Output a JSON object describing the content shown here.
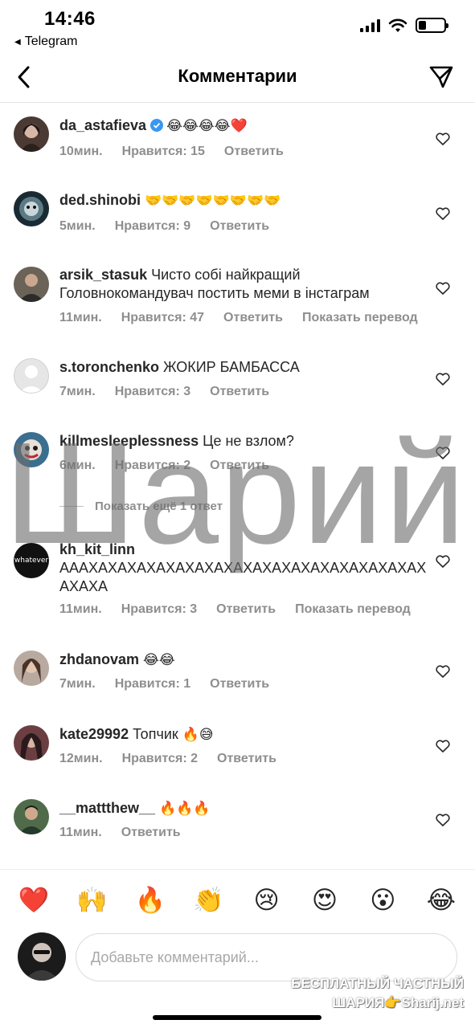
{
  "status_bar": {
    "time": "14:46",
    "back_app": "Telegram"
  },
  "header": {
    "title": "Комментарии"
  },
  "comments": [
    {
      "username": "da_astafieva",
      "verified": true,
      "text": "",
      "emoji": "😂😂😂😂❤️",
      "time": "10мин.",
      "likes": "Нравится: 15",
      "reply": "Ответить"
    },
    {
      "username": "ded.shinobi",
      "text": "",
      "emoji": "🤝🤝🤝🤝🤝🤝🤝🤝",
      "time": "5мин.",
      "likes": "Нравится: 9",
      "reply": "Ответить"
    },
    {
      "username": "arsik_stasuk",
      "text": "Чисто собі найкращий Головнокомандувач постить меми в інстаграм",
      "time": "11мин.",
      "likes": "Нравится: 47",
      "reply": "Ответить",
      "translate": "Показать перевод"
    },
    {
      "username": "s.toronchenko",
      "text": "ЖОКИР БАМБАССА",
      "time": "7мин.",
      "likes": "Нравится: 3",
      "reply": "Ответить"
    },
    {
      "username": "killmesleeplessness",
      "text": "Це не взлом?",
      "time": "6мин.",
      "likes": "Нравится: 2",
      "reply": "Ответить"
    },
    {
      "username": "kh_kit_linn",
      "text": "АААХАХАХАХАХАХАХАХАХАХАХАХАХАХАХАХАХАХАХАХА",
      "time": "11мин.",
      "likes": "Нравится: 3",
      "reply": "Ответить",
      "translate": "Показать перевод",
      "avatar_text": "whatever"
    },
    {
      "username": "zhdanovam",
      "text": "",
      "emoji": "😂😂",
      "time": "7мин.",
      "likes": "Нравится: 1",
      "reply": "Ответить"
    },
    {
      "username": "kate29992",
      "text": "Топчик",
      "emoji": "🔥😅",
      "time": "12мин.",
      "likes": "Нравится: 2",
      "reply": "Ответить"
    },
    {
      "username": "__mattthew__",
      "text": "",
      "emoji": "🔥🔥🔥",
      "time": "11мин.",
      "likes": "",
      "reply": "Ответить"
    }
  ],
  "more_replies": "Показать ещё 1 ответ",
  "watermark": "Шарий",
  "reactions": [
    "❤️",
    "🙌",
    "🔥",
    "👏",
    "😢",
    "😍",
    "😮",
    "😂"
  ],
  "composer": {
    "placeholder": "Добавьте комментарий..."
  },
  "watermark_bottom": {
    "line1": "БЕСПЛАТНЫЙ ЧАСТНЫЙ",
    "line2": "ШАРИЯ👉Sharij.net"
  },
  "colors": {
    "text": "#262626",
    "meta": "#8e8e8e",
    "verified": "#3897f0",
    "border": "#dbdbdb"
  },
  "icons": {
    "back": "chevron-left-icon",
    "share": "paper-plane-icon",
    "like": "heart-outline-icon",
    "verified": "verified-badge-icon"
  }
}
